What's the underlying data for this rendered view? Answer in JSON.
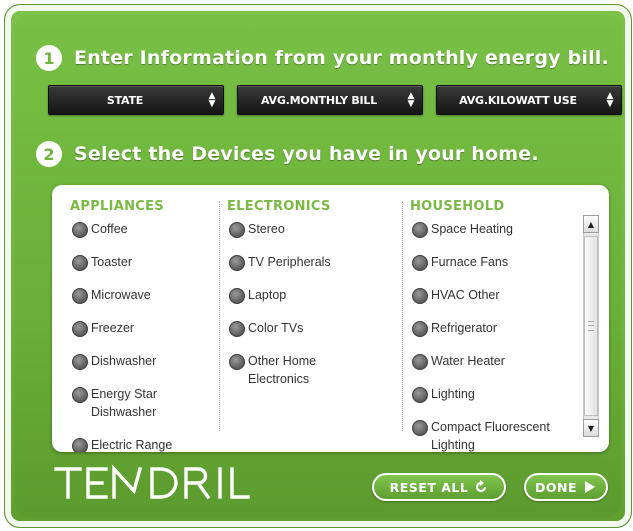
{
  "step1": {
    "number": "1",
    "text": "Enter Information from your monthly energy bill."
  },
  "selects": [
    {
      "label": "STATE"
    },
    {
      "label": "AVG.MONTHLY BILL"
    },
    {
      "label": "AVG.KILOWATT USE"
    }
  ],
  "step2": {
    "number": "2",
    "text": "Select the Devices you have in your home."
  },
  "columns": {
    "appliances": {
      "heading": "APPLIANCES",
      "items": [
        "Coffee",
        "Toaster",
        "Microwave",
        "Freezer",
        "Dishwasher",
        "Energy Star Dishwasher",
        "Electric Range"
      ]
    },
    "electronics": {
      "heading": "ELECTRONICS",
      "items": [
        "Stereo",
        "TV Peripherals",
        "Laptop",
        "Color TVs",
        "Other Home Electronics"
      ]
    },
    "household": {
      "heading": "HOUSEHOLD",
      "items": [
        "Space Heating",
        "Furnace Fans",
        "HVAC Other",
        "Refrigerator",
        "Water Heater",
        "Lighting",
        "Compact Fluorescent Lighting"
      ]
    }
  },
  "logo": "TE DRIL",
  "buttons": {
    "reset": "RESET ALL",
    "done": "DONE"
  },
  "colors": {
    "brand_green": "#6fb53d",
    "heading_green": "#7ab943",
    "select_bg": "#1f1f1f"
  }
}
